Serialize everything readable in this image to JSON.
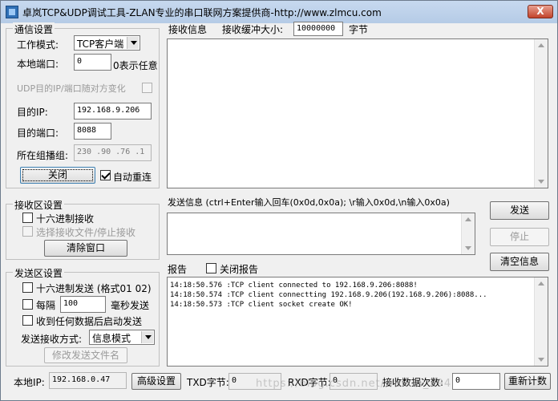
{
  "window": {
    "title": "卓岚TCP&UDP调试工具-ZLAN专业的串口联网方案提供商-http://www.zlmcu.com",
    "close_label": "X"
  },
  "comm": {
    "legend": "通信设置",
    "mode_label": "工作模式:",
    "mode_value": "TCP客户端",
    "local_port_label": "本地端口:",
    "local_port_value": "0",
    "local_port_hint": "0表示任意",
    "udp_random_label": "UDP目的IP/端口随对方变化",
    "dest_ip_label": "目的IP:",
    "dest_ip_value": "192.168.9.206",
    "dest_port_label": "目的端口:",
    "dest_port_value": "8088",
    "multicast_label": "所在组播组:",
    "multicast_value": "230 .90 .76 .1",
    "close_button": "关闭",
    "auto_reconnect_label": "自动重连",
    "auto_reconnect_checked": true
  },
  "recv_settings": {
    "legend": "接收区设置",
    "hex_label": "十六进制接收",
    "file_label": "选择接收文件/停止接收",
    "clear_button": "清除窗口"
  },
  "send_settings": {
    "legend": "发送区设置",
    "hex_label": "十六进制发送 (格式01 02)",
    "interval_label": "每隔",
    "interval_value": "100",
    "interval_unit": "毫秒发送",
    "on_receive_label": "收到任何数据后启动发送",
    "send_mode_label": "发送接收方式:",
    "send_mode_value": "信息模式",
    "modify_file_button": "修改发送文件名"
  },
  "receive": {
    "label": "接收信息",
    "buffer_label": "接收缓冲大小:",
    "buffer_value": "10000000",
    "buffer_unit": "字节"
  },
  "send": {
    "label": "发送信息 (ctrl+Enter输入回车(0x0d,0x0a); \\r输入0x0d,\\n输入0x0a)",
    "send_button": "发送",
    "stop_button": "停止",
    "clear_info_button": "清空信息"
  },
  "report": {
    "label": "报告",
    "close_report_label": "关闭报告",
    "lines": [
      "14:18:50.576 :TCP client connected to 192.168.9.206:8088!",
      "14:18:50.574 :TCP client connectting 192.168.9.206(192.168.9.206):8088...",
      "14:18:50.573 :TCP client socket create OK!"
    ]
  },
  "status": {
    "local_ip_label": "本地IP:",
    "local_ip_value": "192.168.0.47",
    "advanced_button": "高级设置",
    "txd_label": "TXD字节:",
    "txd_value": "0",
    "rxd_label": "RXD字节:",
    "rxd_value": "0",
    "recv_count_label": "接收数据次数:",
    "recv_count_value": "0",
    "recount_button": "重新计数"
  },
  "watermark": "https://blog.csdn.net/weixin_294"
}
